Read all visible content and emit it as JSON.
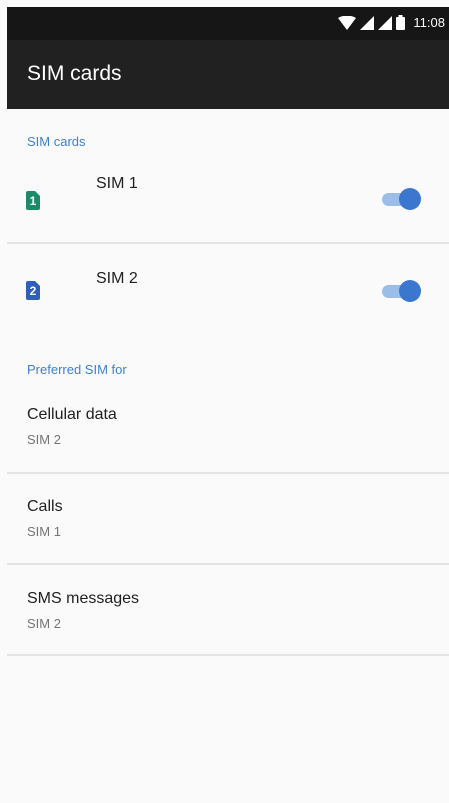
{
  "status_bar": {
    "time": "11:08",
    "icons": [
      "wifi-icon",
      "signal-icon",
      "signal-icon",
      "battery-icon"
    ]
  },
  "app_bar": {
    "title": "SIM cards"
  },
  "sim_section": {
    "header": "SIM cards",
    "items": [
      {
        "icon_number": "1",
        "label": "SIM 1",
        "enabled": true,
        "icon_color": "#1b8a6b"
      },
      {
        "icon_number": "2",
        "label": "SIM 2",
        "enabled": true,
        "icon_color": "#2f5fb8"
      }
    ]
  },
  "preferred_section": {
    "header": "Preferred SIM for",
    "items": [
      {
        "title": "Cellular data",
        "summary": "SIM 2"
      },
      {
        "title": "Calls",
        "summary": "SIM 1"
      },
      {
        "title": "SMS messages",
        "summary": "SIM 2"
      }
    ]
  },
  "colors": {
    "accent": "#3f7fd1",
    "toggle_thumb": "#3b76cf",
    "toggle_track": "#9dbde9",
    "app_bar": "#212121",
    "status_bar": "#161616"
  }
}
